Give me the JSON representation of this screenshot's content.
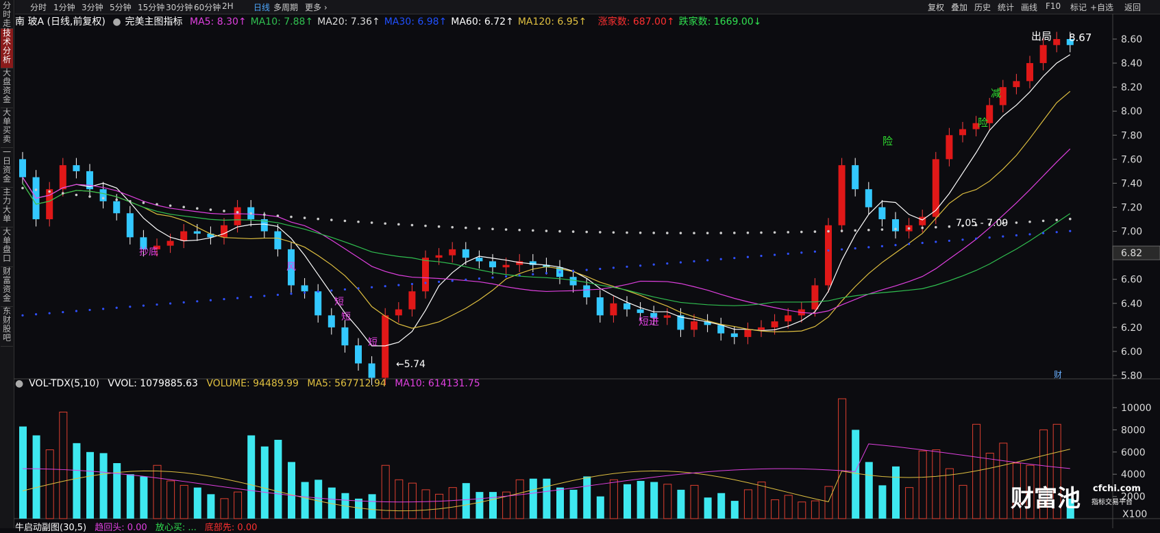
{
  "left_tabs": [
    "分时走势",
    "技术分析",
    "大盘资金",
    "大单买卖",
    "一日资金",
    "主力大单",
    "大单盘口",
    "财富资金",
    "东财股吧"
  ],
  "period_tabs": [
    "分时",
    "1分钟",
    "3分钟",
    "5分钟",
    "15分钟",
    "30分钟",
    "60分钟",
    "2H",
    "日线",
    "多周期",
    "更多 ›"
  ],
  "active_period": "日线",
  "right_tools": [
    "复权",
    "叠加",
    "历史",
    "统计",
    "画线",
    "F10",
    "标记",
    "+自选",
    "返回"
  ],
  "stock_title": "南 玻A (日线,前复权)",
  "indicator_name": "完美主图指标",
  "ma": [
    {
      "label": "MA5: 8.30",
      "color": "#e040e0"
    },
    {
      "label": "MA10: 7.88",
      "color": "#30c050"
    },
    {
      "label": "MA20: 7.36",
      "color": "#dddddd"
    },
    {
      "label": "MA30: 6.98",
      "color": "#2050ff"
    },
    {
      "label": "MA60: 6.72",
      "color": "#ffffff"
    },
    {
      "label": "MA120: 6.95",
      "color": "#e0c040"
    }
  ],
  "breadth": [
    {
      "label": "涨家数: 687.00",
      "color": "#ff3030"
    },
    {
      "label": "跌家数: 1669.00",
      "color": "#30e050"
    }
  ],
  "price_axis": [
    "8.60",
    "8.40",
    "8.20",
    "8.00",
    "7.80",
    "7.60",
    "7.40",
    "7.20",
    "7.00",
    "6.80",
    "6.60",
    "6.40",
    "6.20",
    "6.00",
    "5.80"
  ],
  "current_price": "6.82",
  "annotations": {
    "high": "8.67",
    "low": "←5.74",
    "range": "7.05 - 7.09",
    "exit": "出局",
    "risk1": "险",
    "risk2": "险",
    "reduce": "减",
    "short_in": "短进",
    "cai": "财",
    "labels": [
      "抄底",
      "风",
      "短",
      "短",
      "短"
    ]
  },
  "volume_indicator": {
    "title": "VOL-TDX(5,10)",
    "vvol": "VVOL: 1079885.63",
    "volume": "VOLUME: 94489.99",
    "ma5": "MA5: 567712.94",
    "ma10": "MA10: 614131.75"
  },
  "vol_axis": [
    "10000",
    "8000",
    "6000",
    "4000",
    "2000"
  ],
  "vol_unit": "X100",
  "bottom_indicator": {
    "title": "牛启动副图(30,5)",
    "items": [
      "趋回头: 0.00",
      "放心买: ...",
      "底部先: 0.00"
    ]
  },
  "watermark": {
    "brand": "财富池",
    "domain": "cfchi.com",
    "sub": "指标交易平台"
  }
}
